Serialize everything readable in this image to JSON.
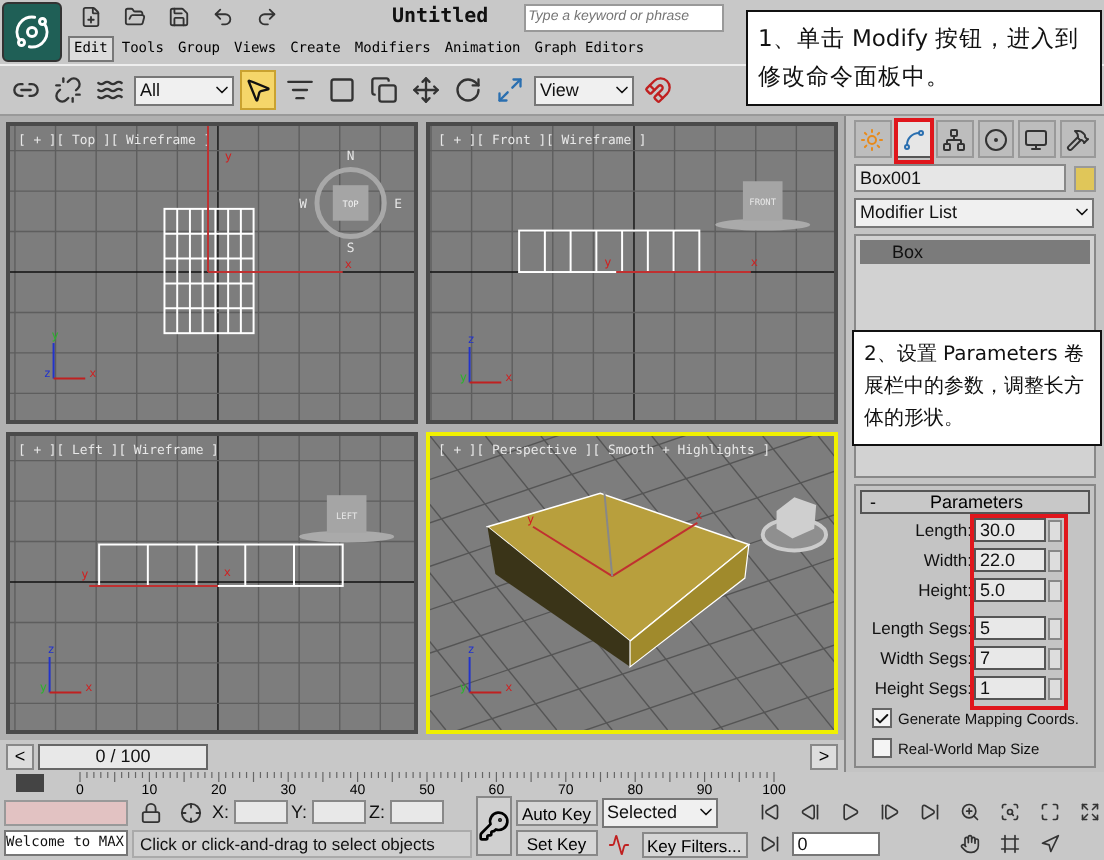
{
  "app": {
    "title": "Untitled",
    "search": {
      "placeholder": "Type a keyword or phrase"
    }
  },
  "menu": [
    {
      "label": "Edit",
      "selected": true
    },
    {
      "label": "Tools",
      "selected": false
    },
    {
      "label": "Group",
      "selected": false
    },
    {
      "label": "Views",
      "selected": false
    },
    {
      "label": "Create",
      "selected": false
    },
    {
      "label": "Modifiers",
      "selected": false
    },
    {
      "label": "Animation",
      "selected": false
    },
    {
      "label": "Graph Editors",
      "selected": false
    }
  ],
  "toolbar": {
    "selection_filter": "All",
    "reference_coordinate_system": "View"
  },
  "viewports": [
    {
      "kind": "top",
      "label": "[ + ][ Top ][ Wireframe ]",
      "selected": false,
      "cube_label": "TOP",
      "compass": [
        "N",
        "W",
        "E",
        "S"
      ],
      "gizmo_labels": [
        "y",
        "x"
      ],
      "triad_labels": [
        "y",
        "z",
        "x"
      ]
    },
    {
      "kind": "front",
      "label": "[ + ][ Front ][ Wireframe ]",
      "selected": false,
      "cube_label": "FRONT",
      "gizmo_labels": [
        "y",
        "x"
      ],
      "triad_labels": [
        "z",
        "y",
        "x"
      ]
    },
    {
      "kind": "left",
      "label": "[ + ][ Left ][ Wireframe ]",
      "selected": false,
      "cube_label": "LEFT",
      "gizmo_labels": [
        "y",
        "x"
      ],
      "triad_labels": [
        "z",
        "y",
        "x"
      ]
    },
    {
      "kind": "perspective",
      "label": "[ + ][ Perspective ][ Smooth + Highlights ]",
      "selected": true,
      "gizmo_labels": [
        "y",
        "x"
      ],
      "triad_labels": [
        "z",
        "y",
        "x"
      ]
    }
  ],
  "time_slider": {
    "prev": "<",
    "position": "0 / 100",
    "next": ">"
  },
  "track_bar": {
    "ticks": [
      "0",
      "10",
      "20",
      "30",
      "40",
      "50",
      "60",
      "70",
      "80",
      "90",
      "100"
    ]
  },
  "command_panel": {
    "tabs": [
      {
        "kind": "create",
        "selected": false
      },
      {
        "kind": "modify",
        "selected": true
      },
      {
        "kind": "hierarchy",
        "selected": false
      },
      {
        "kind": "motion",
        "selected": false
      },
      {
        "kind": "display",
        "selected": false
      },
      {
        "kind": "utilities",
        "selected": false
      }
    ],
    "object_name": "Box001",
    "modifier_list": "Modifier List",
    "stack": [
      {
        "label": "Box",
        "selected": true
      }
    ],
    "rollout": {
      "sign": "-",
      "title": "Parameters",
      "expanded": true,
      "fields": [
        {
          "label": "Length:",
          "value": "30.0"
        },
        {
          "label": "Width:",
          "value": "22.0"
        },
        {
          "label": "Height:",
          "value": "5.0"
        },
        {
          "label": "Length Segs:",
          "value": "5"
        },
        {
          "label": "Width Segs:",
          "value": "7"
        },
        {
          "label": "Height Segs:",
          "value": "1"
        }
      ],
      "checkboxes": [
        {
          "label": "Generate Mapping Coords.",
          "checked": true
        },
        {
          "label": "Real-World Map Size",
          "checked": false
        }
      ]
    }
  },
  "status": {
    "listener": "Welcome to MAX",
    "x_label": "X:",
    "y_label": "Y:",
    "z_label": "Z:",
    "prompt": "Click or click-and-drag to select objects",
    "auto_key": "Auto Key",
    "set_key": "Set Key",
    "key_mode": "Selected",
    "key_filters": "Key Filters...",
    "frame": "0"
  },
  "callouts": [
    {
      "text": "1、单击 Modify 按钮，进入到修改命令面板中。"
    },
    {
      "text": "2、设置 Parameters 卷展栏中的参数，调整长方体的形状。"
    }
  ]
}
